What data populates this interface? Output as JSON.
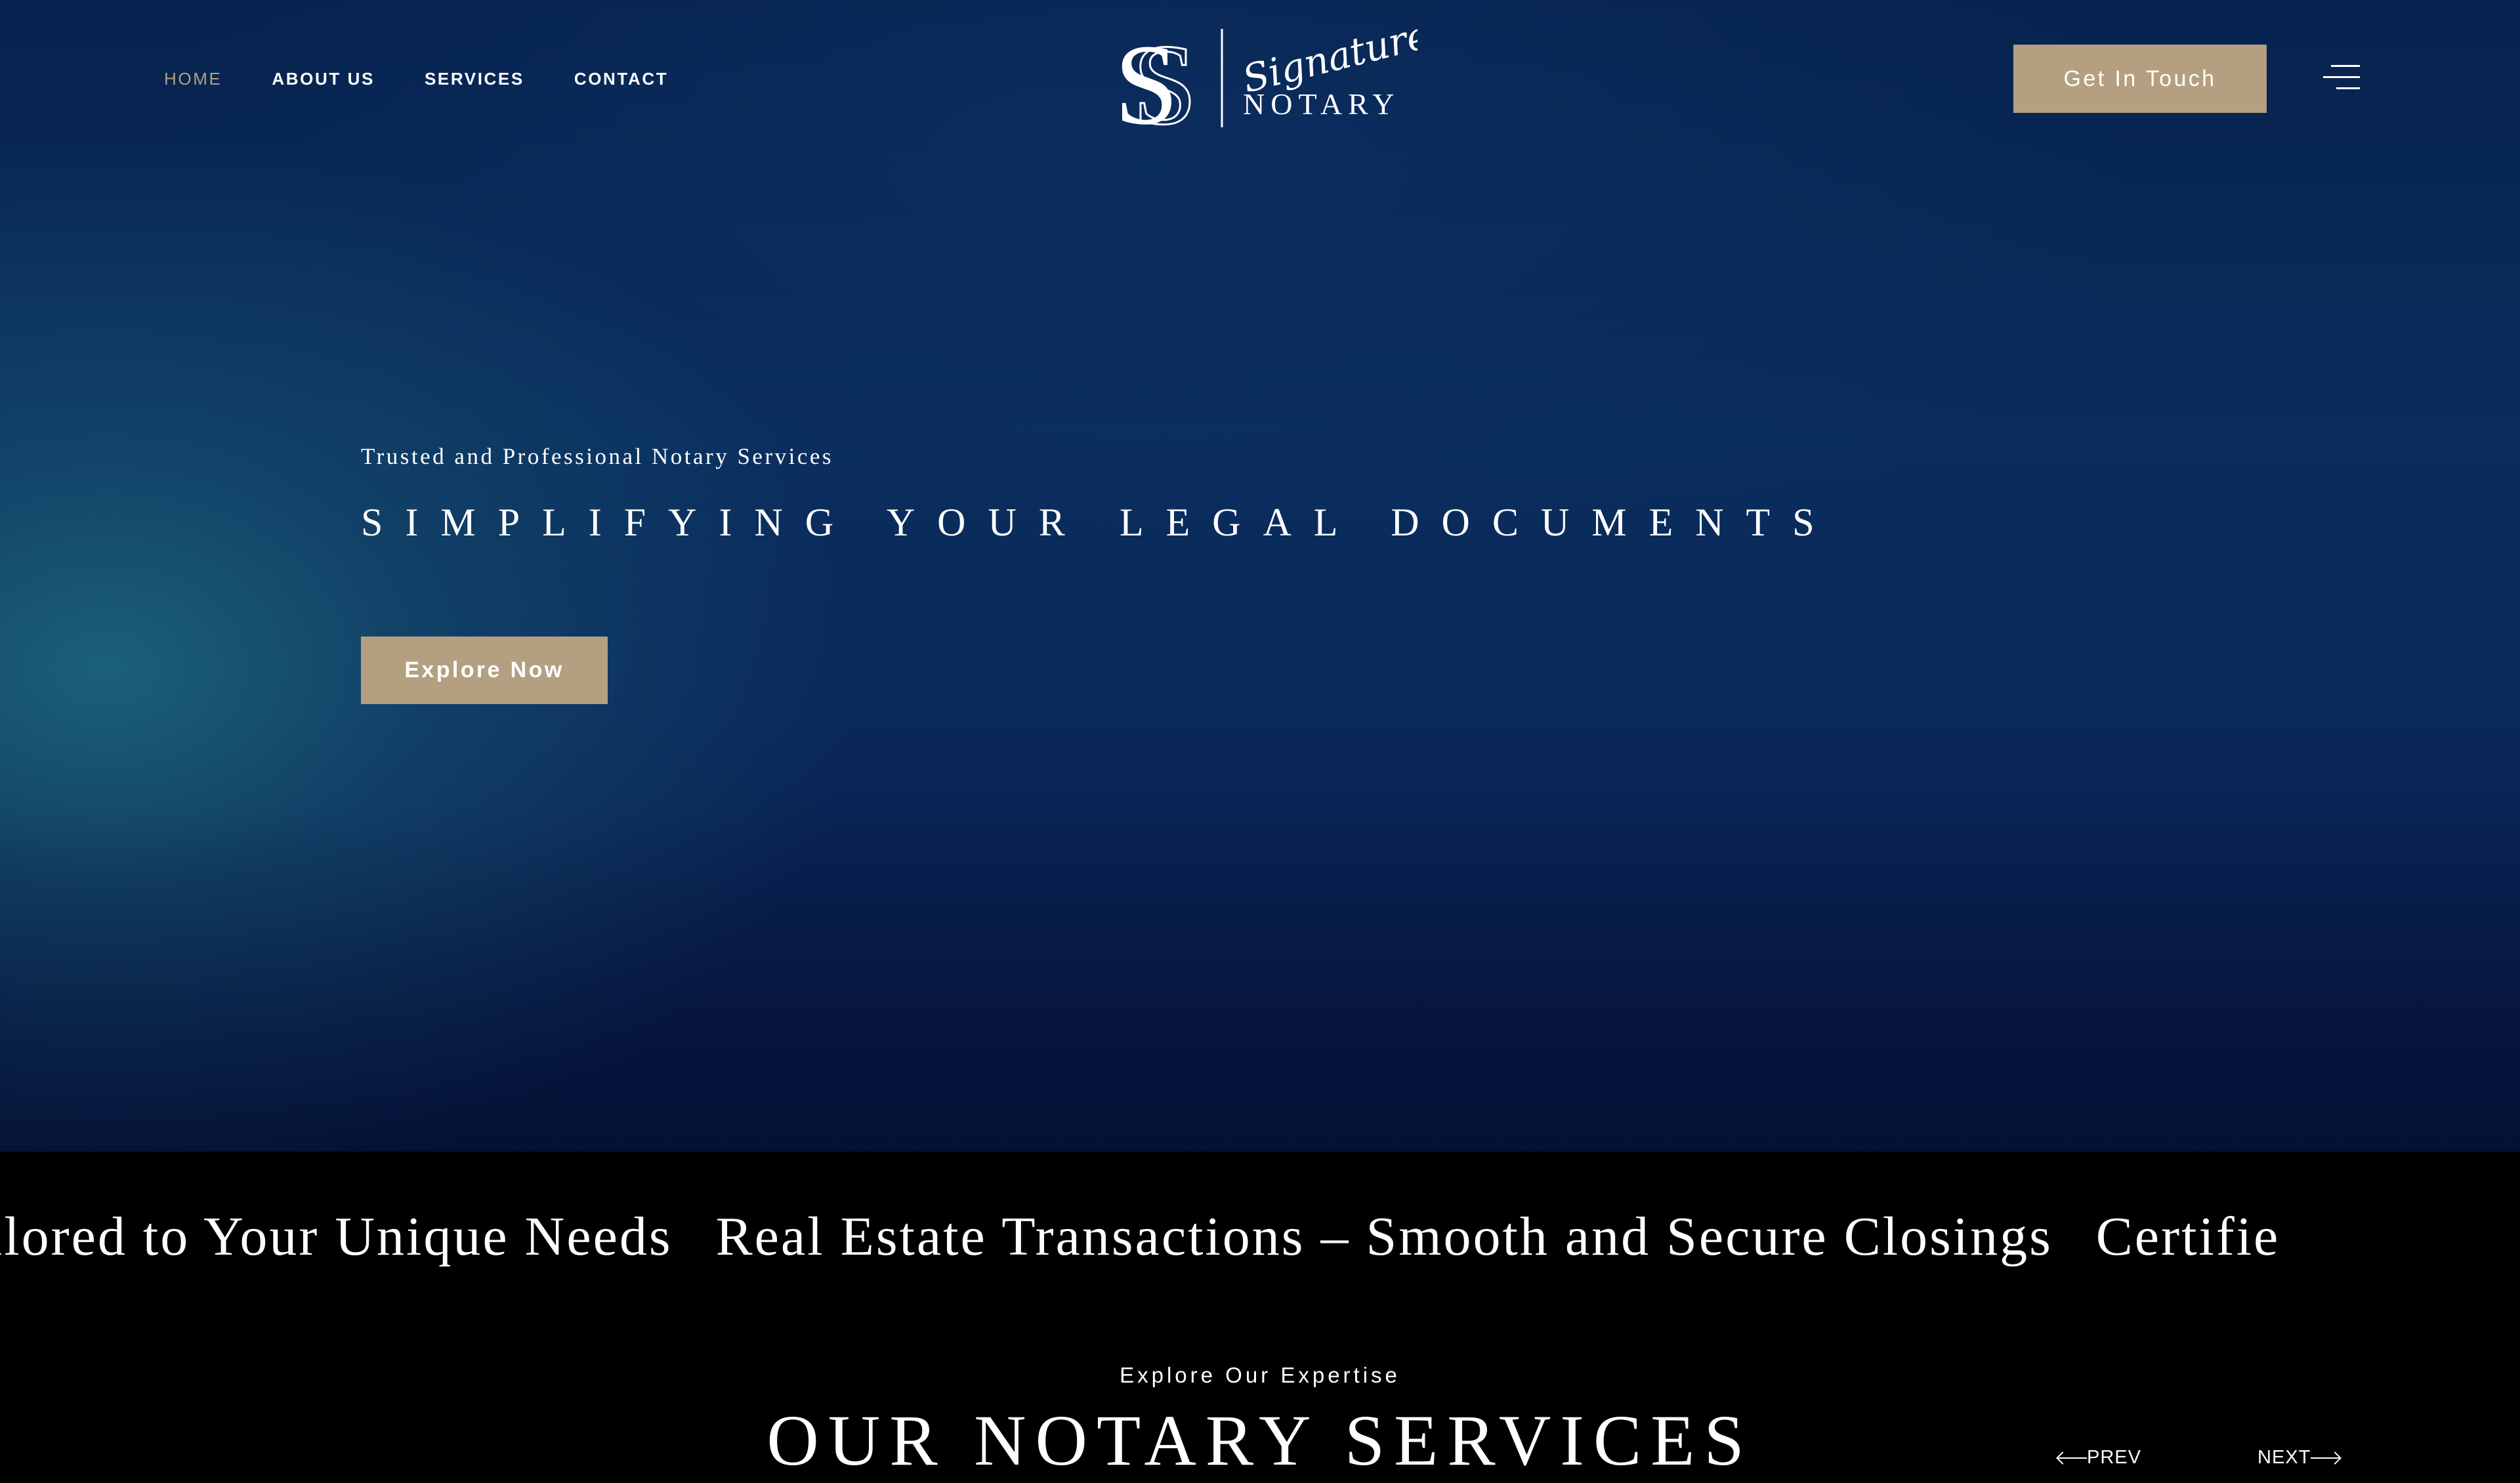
{
  "header": {
    "nav": [
      {
        "label": "HOME",
        "active": true
      },
      {
        "label": "ABOUT US",
        "active": false
      },
      {
        "label": "SERVICES",
        "active": false
      },
      {
        "label": "CONTACT",
        "active": false
      }
    ],
    "logo": {
      "monogram": "S",
      "script": "Signature",
      "word": "NOTARY"
    },
    "cta_label": "Get In Touch",
    "menu_icon": "hamburger-menu-icon"
  },
  "hero": {
    "tagline": "Trusted and Professional Notary Services",
    "headline": "SIMPLIFYING YOUR LEGAL DOCUMENTS",
    "button_label": "Explore Now"
  },
  "marquee": {
    "items": [
      "ilored to Your Unique Needs",
      "Real Estate Transactions – Smooth and Secure Closings",
      "Certifie"
    ]
  },
  "services": {
    "eyebrow": "Explore Our Expertise",
    "title": "OUR NOTARY SERVICES",
    "prev_label": "PREV",
    "next_label": "NEXT"
  },
  "colors": {
    "accent": "#b4a080",
    "hero_dark": "#07224e",
    "hero_teal": "#1c647a",
    "section_bg": "#000000",
    "text": "#ffffff"
  }
}
